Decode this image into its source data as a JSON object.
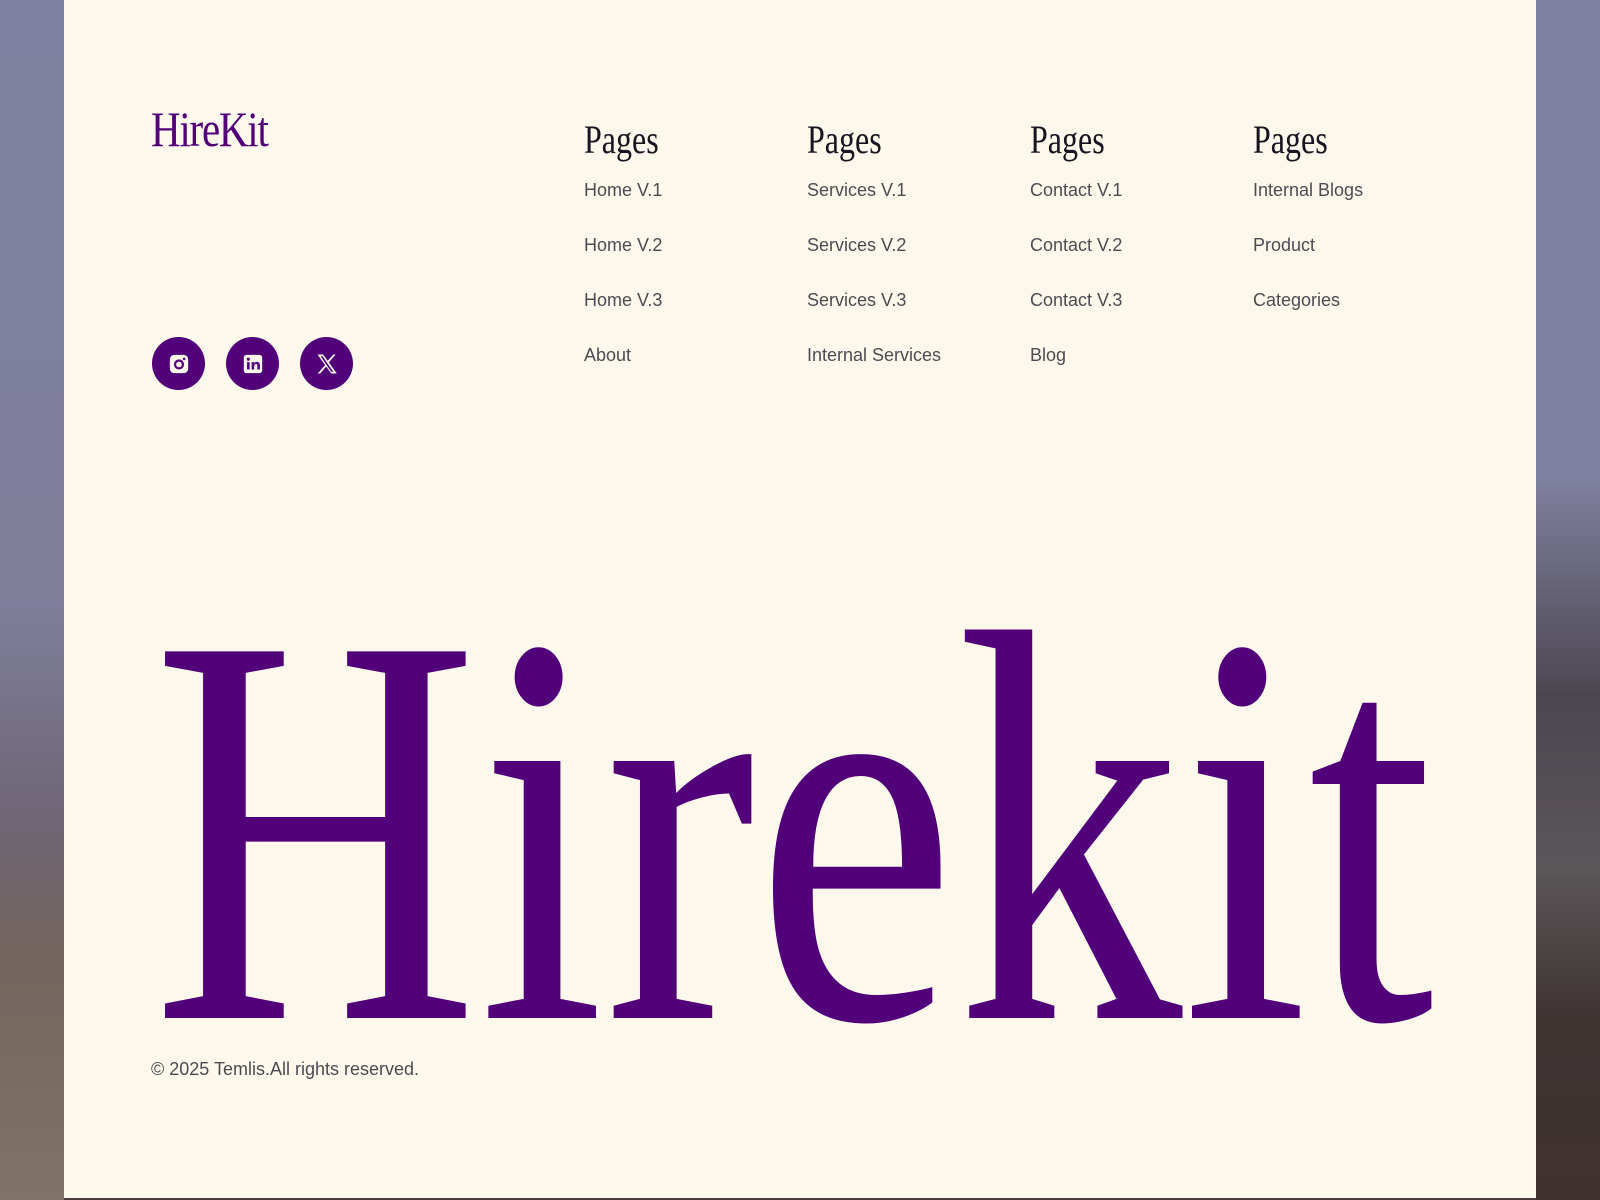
{
  "footer": {
    "logo": "HireKit",
    "brand_color": "#52007a",
    "background_color": "#fcf9ec",
    "socials": [
      {
        "icon": "instagram-icon"
      },
      {
        "icon": "linkedin-icon"
      },
      {
        "icon": "x-twitter-icon"
      }
    ],
    "columns": [
      {
        "heading": "Pages",
        "links": [
          "Home V.1",
          "Home V.2",
          "Home V.3",
          "About"
        ]
      },
      {
        "heading": "Pages",
        "links": [
          "Services V.1",
          "Services V.2",
          "Services V.3",
          "Internal Services"
        ]
      },
      {
        "heading": "Pages",
        "links": [
          "Contact V.1",
          "Contact V.2",
          "Contact V.3",
          "Blog"
        ]
      },
      {
        "heading": "Pages",
        "links": [
          "Internal Blogs",
          "Product",
          "Categories"
        ]
      }
    ],
    "big_word": "Hirekit",
    "copyright": "© 2025 Temlis.All rights reserved."
  }
}
